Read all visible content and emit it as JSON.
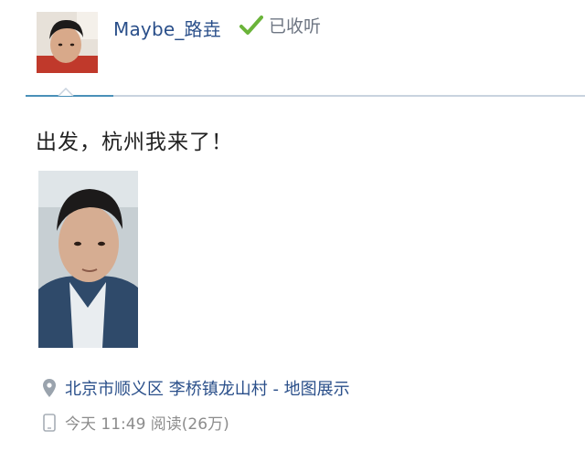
{
  "user": {
    "name": "Maybe_路垚",
    "follow_status": "已收听"
  },
  "post": {
    "text": "出发，杭州我来了！",
    "location": "北京市顺义区 李桥镇龙山村 - 地图展示",
    "meta": "今天 11:49 阅读(26万)"
  },
  "icons": {
    "follow": "check-icon",
    "location": "location-pin-icon",
    "device": "mobile-phone-icon"
  },
  "colors": {
    "link": "#2a4f8a",
    "check": "#6bb43a",
    "divider": "#c9d3df",
    "divider_accent": "#4a90b8",
    "meta": "#8c8c8c"
  }
}
